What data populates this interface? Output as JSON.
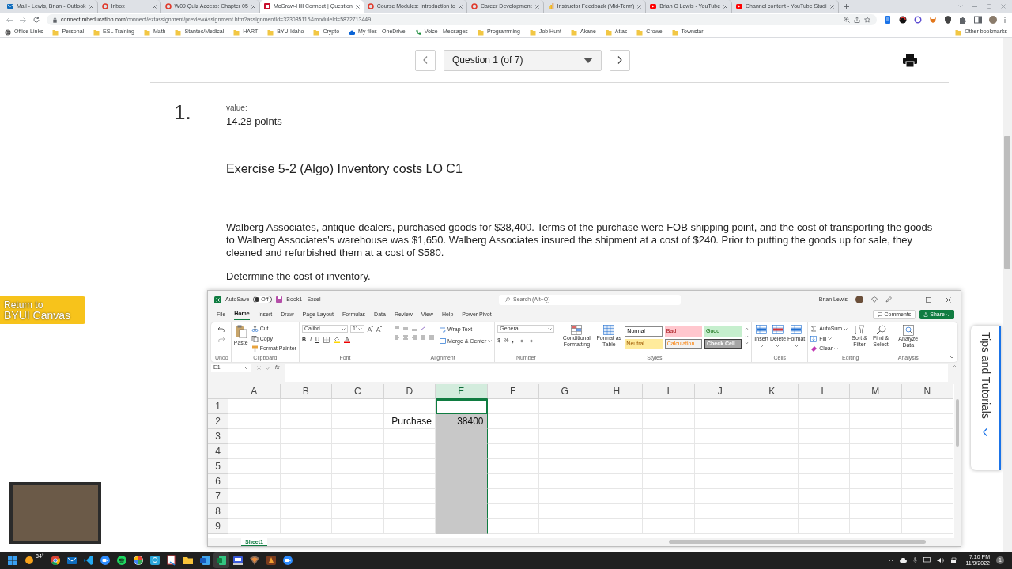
{
  "browser": {
    "tabs": [
      {
        "title": "Mail - Lewis, Brian - Outlook",
        "kind": "mail",
        "selected": false
      },
      {
        "title": "Inbox",
        "kind": "ring",
        "selected": false
      },
      {
        "title": "W09 Quiz Access: Chapter 05",
        "kind": "ring",
        "selected": false
      },
      {
        "title": "McGraw-Hill Connect | Question",
        "kind": "badge",
        "selected": true
      },
      {
        "title": "Course Modules: Introduction to",
        "kind": "ring",
        "selected": false
      },
      {
        "title": "Career Development",
        "kind": "ring",
        "selected": false
      },
      {
        "title": "Instructor Feedback (Mid-Term)",
        "kind": "chart",
        "selected": false
      },
      {
        "title": "Brian C Lewis - YouTube",
        "kind": "play",
        "selected": false
      },
      {
        "title": "Channel content - YouTube Studi",
        "kind": "play",
        "selected": false
      }
    ],
    "url_host": "connect.mheducation.com",
    "url_path": "/connect/eztassignment/previewAssignment.htm?assignmentId=323085115&moduleId=5872713449",
    "bookmarks": [
      {
        "label": "Office Links",
        "kind": "globe"
      },
      {
        "label": "Personal",
        "kind": "folder"
      },
      {
        "label": "ESL Training",
        "kind": "folder"
      },
      {
        "label": "Math",
        "kind": "folder"
      },
      {
        "label": "Stantec/Medical",
        "kind": "folder"
      },
      {
        "label": "HART",
        "kind": "folder"
      },
      {
        "label": "BYU-Idaho",
        "kind": "folder"
      },
      {
        "label": "Crypto",
        "kind": "folder"
      },
      {
        "label": "My files - OneDrive",
        "kind": "cloud"
      },
      {
        "label": "Voice - Messages",
        "kind": "phone"
      },
      {
        "label": "Programming",
        "kind": "folder"
      },
      {
        "label": "Job Hunt",
        "kind": "folder"
      },
      {
        "label": "Akane",
        "kind": "folder"
      },
      {
        "label": "Atlas",
        "kind": "folder"
      },
      {
        "label": "Crowe",
        "kind": "folder"
      },
      {
        "label": "Townstar",
        "kind": "folder"
      }
    ],
    "other_bookmarks": "Other bookmarks"
  },
  "question_nav": {
    "label": "Question 1 (of 7)"
  },
  "question": {
    "number": "1.",
    "value_label": "value:",
    "points": "14.28 points",
    "title": "Exercise 5-2 (Algo) Inventory costs LO C1",
    "body": "Walberg Associates, antique dealers, purchased goods for $38,400. Terms of the purchase were FOB shipping point, and the cost of transporting the goods to Walberg Associates's warehouse was $1,650. Walberg Associates insured the shipment at a cost of $240. Prior to putting the goods up for sale, they cleaned and refurbished them at a cost of $580.",
    "prompt": "Determine the cost of inventory."
  },
  "canvas_button": {
    "line_1": "Return to",
    "line_2": "BYUI Canvas"
  },
  "tips_tab": "Tips and Tutorials",
  "excel": {
    "autosave_label": "AutoSave",
    "autosave_on": false,
    "toggle_text": "Off",
    "title": "Book1 - Excel",
    "search_placeholder": "Search (Alt+Q)",
    "user": "Brian Lewis",
    "menu": [
      {
        "label": "File",
        "selected": false
      },
      {
        "label": "Home",
        "selected": true
      },
      {
        "label": "Insert",
        "selected": false
      },
      {
        "label": "Draw",
        "selected": false
      },
      {
        "label": "Page Layout",
        "selected": false
      },
      {
        "label": "Formulas",
        "selected": false
      },
      {
        "label": "Data",
        "selected": false
      },
      {
        "label": "Review",
        "selected": false
      },
      {
        "label": "View",
        "selected": false
      },
      {
        "label": "Help",
        "selected": false
      },
      {
        "label": "Power Pivot",
        "selected": false
      }
    ],
    "comments": "Comments",
    "share": "Share",
    "ribbon": {
      "undo": {
        "caption": "Undo"
      },
      "clipboard": {
        "paste": "Paste",
        "cut": "Cut",
        "copy": "Copy",
        "format_painter": "Format Painter",
        "caption": "Clipboard"
      },
      "font": {
        "name": "Calibri",
        "size": "11",
        "bold": "B",
        "italic": "I",
        "underline": "U",
        "caption": "Font"
      },
      "alignment": {
        "wrap_text": "Wrap Text",
        "merge_center": "Merge & Center",
        "caption": "Alignment"
      },
      "number": {
        "format": "General",
        "currency": "$",
        "percent": "%",
        "comma": ",",
        "caption": "Number"
      },
      "styles": {
        "conditional": "Conditional Formatting",
        "format_table": "Format as Table",
        "caption": "Styles",
        "cells": [
          {
            "label": "Normal",
            "kind": "normal"
          },
          {
            "label": "Bad",
            "kind": "bad"
          },
          {
            "label": "Good",
            "kind": "good"
          },
          {
            "label": "Neutral",
            "kind": "neutral"
          },
          {
            "label": "Calculation",
            "kind": "calculation"
          },
          {
            "label": "Check Cell",
            "kind": "check"
          }
        ]
      },
      "cells": {
        "buttons": [
          {
            "label": "Insert",
            "kind": "insert"
          },
          {
            "label": "Delete",
            "kind": "delete"
          },
          {
            "label": "Format",
            "kind": "format"
          }
        ],
        "caption": "Cells"
      },
      "editing": {
        "autosum": "AutoSum",
        "fill": "Fill",
        "clear": "Clear",
        "sort": "Sort & Filter",
        "find": "Find & Select",
        "caption": "Editing"
      },
      "analysis": {
        "analyze": "Analyze Data",
        "caption": "Analysis"
      }
    },
    "name_box": "E1",
    "fx": "fx",
    "columns": [
      {
        "label": "A",
        "selected": false
      },
      {
        "label": "B",
        "selected": false
      },
      {
        "label": "C",
        "selected": false
      },
      {
        "label": "D",
        "selected": false
      },
      {
        "label": "E",
        "selected": true
      },
      {
        "label": "F",
        "selected": false
      },
      {
        "label": "G",
        "selected": false
      },
      {
        "label": "H",
        "selected": false
      },
      {
        "label": "I",
        "selected": false
      },
      {
        "label": "J",
        "selected": false
      },
      {
        "label": "K",
        "selected": false
      },
      {
        "label": "L",
        "selected": false
      },
      {
        "label": "M",
        "selected": false
      },
      {
        "label": "N",
        "selected": false
      }
    ],
    "rows": [
      {
        "label": "1"
      },
      {
        "label": "2",
        "cells": {
          "D": "Purchase",
          "E": "38400"
        }
      },
      {
        "label": "3"
      },
      {
        "label": "4"
      },
      {
        "label": "5"
      },
      {
        "label": "6"
      },
      {
        "label": "7"
      },
      {
        "label": "8"
      },
      {
        "label": "9"
      }
    ],
    "sheet_tab": "Sheet1"
  },
  "taskbar": {
    "icons": [
      {
        "kind": "start",
        "selected": false
      },
      {
        "kind": "weather",
        "label": "84°",
        "selected": false
      },
      {
        "kind": "browser",
        "selected": false
      },
      {
        "kind": "mail",
        "selected": false
      },
      {
        "kind": "code",
        "selected": false
      },
      {
        "kind": "video",
        "selected": false
      },
      {
        "kind": "music",
        "selected": false
      },
      {
        "kind": "pinwheel",
        "selected": false
      },
      {
        "kind": "chat",
        "selected": false
      },
      {
        "kind": "snip",
        "selected": false
      },
      {
        "kind": "folder",
        "selected": false
      },
      {
        "kind": "doc",
        "selected": false
      },
      {
        "kind": "sheet",
        "selected": true
      },
      {
        "kind": "scanner",
        "selected": false
      },
      {
        "kind": "app",
        "selected": false
      },
      {
        "kind": "game",
        "selected": false
      },
      {
        "kind": "video",
        "selected": false
      }
    ],
    "time": "7:10 PM",
    "date": "11/9/2022",
    "notifications": "1"
  }
}
